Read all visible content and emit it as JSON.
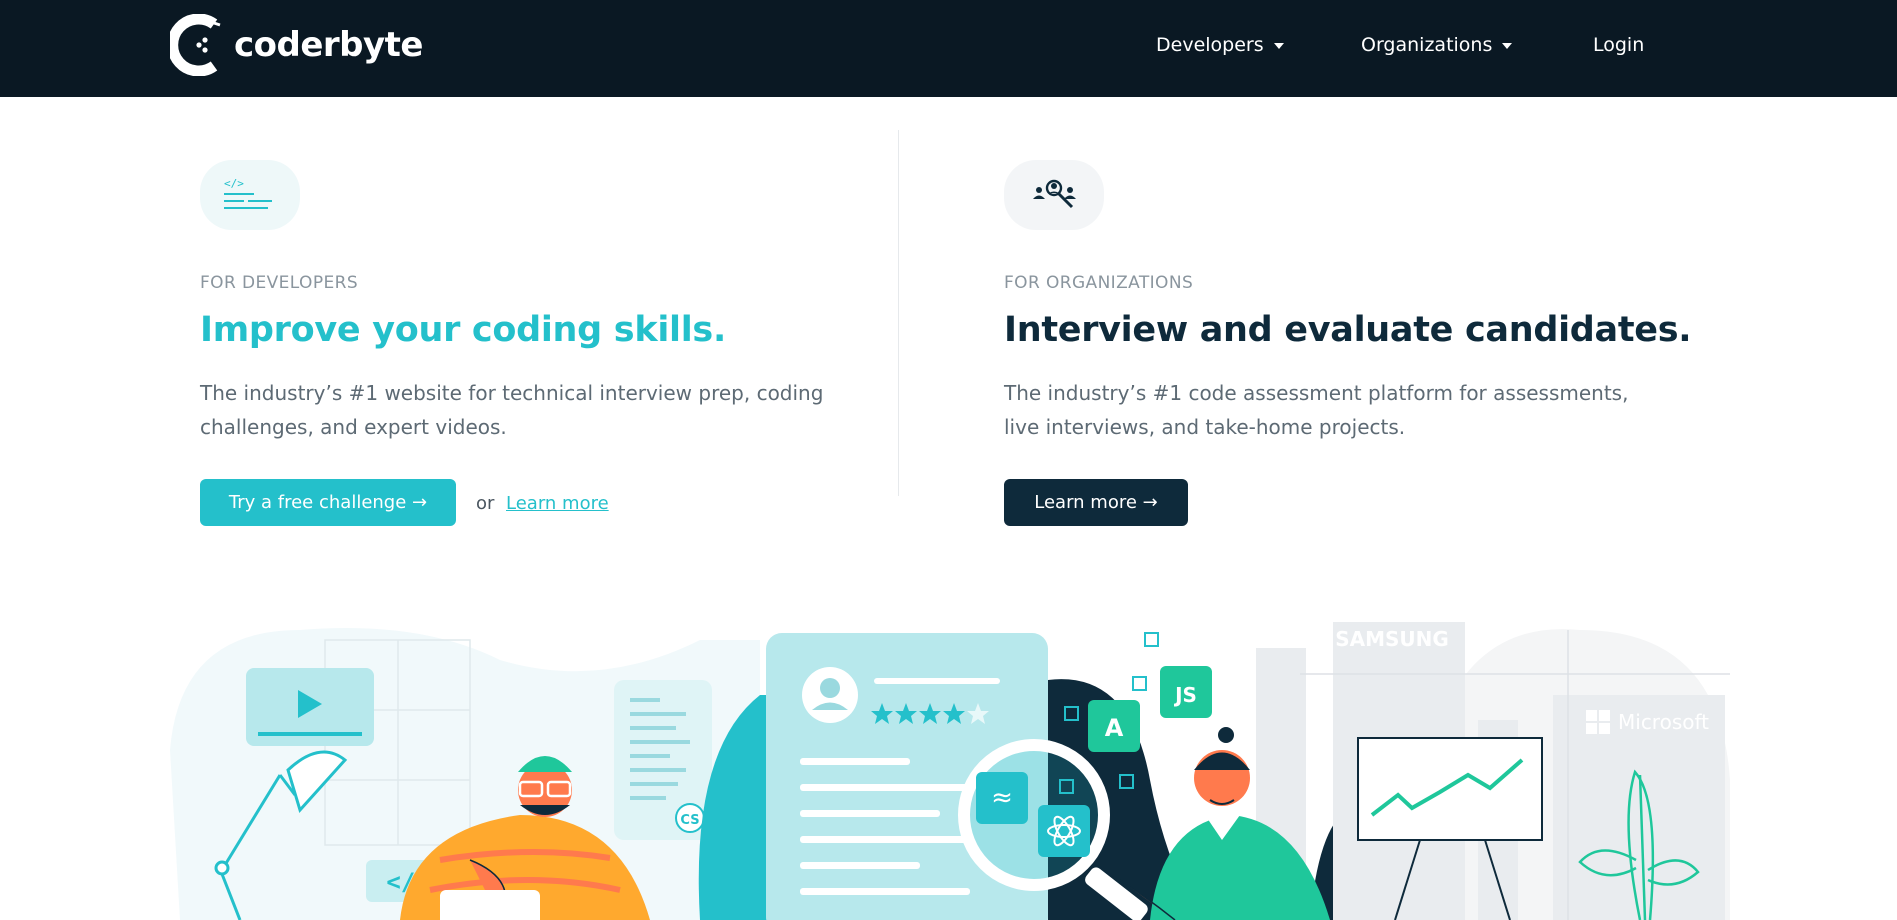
{
  "header": {
    "logo_text": "coderbyte",
    "nav": [
      {
        "label": "Developers",
        "has_dropdown": true
      },
      {
        "label": "Organizations",
        "has_dropdown": true
      },
      {
        "label": "Login",
        "has_dropdown": false
      }
    ]
  },
  "developers": {
    "eyebrow": "FOR DEVELOPERS",
    "headline": "Improve your coding skills.",
    "description_line1": "The industry’s #1 website for technical interview prep, coding",
    "description_line2": "challenges, and expert videos.",
    "cta_label": "Try a free challenge →",
    "or_text": "or",
    "learn_more_label": "Learn more",
    "icon": "code-document-icon"
  },
  "organizations": {
    "eyebrow": "FOR ORGANIZATIONS",
    "headline": "Interview and evaluate candidates.",
    "description_line1": "The industry’s #1 code assessment platform for assessments,",
    "description_line2": "live interviews, and take-home projects.",
    "cta_label": "Learn more →",
    "icon": "people-search-icon"
  },
  "illustration": {
    "code_tag": "</>",
    "cs_badge": "CS",
    "js_badge": "JS",
    "angular_badge": "A",
    "company_logos": [
      "SAMSUNG",
      "Microsoft"
    ]
  },
  "colors": {
    "nav_bg": "#0a1823",
    "teal": "#24c0cb",
    "navy": "#0e2a3b",
    "green": "#1fc79b",
    "orange": "#ff7a4d"
  }
}
